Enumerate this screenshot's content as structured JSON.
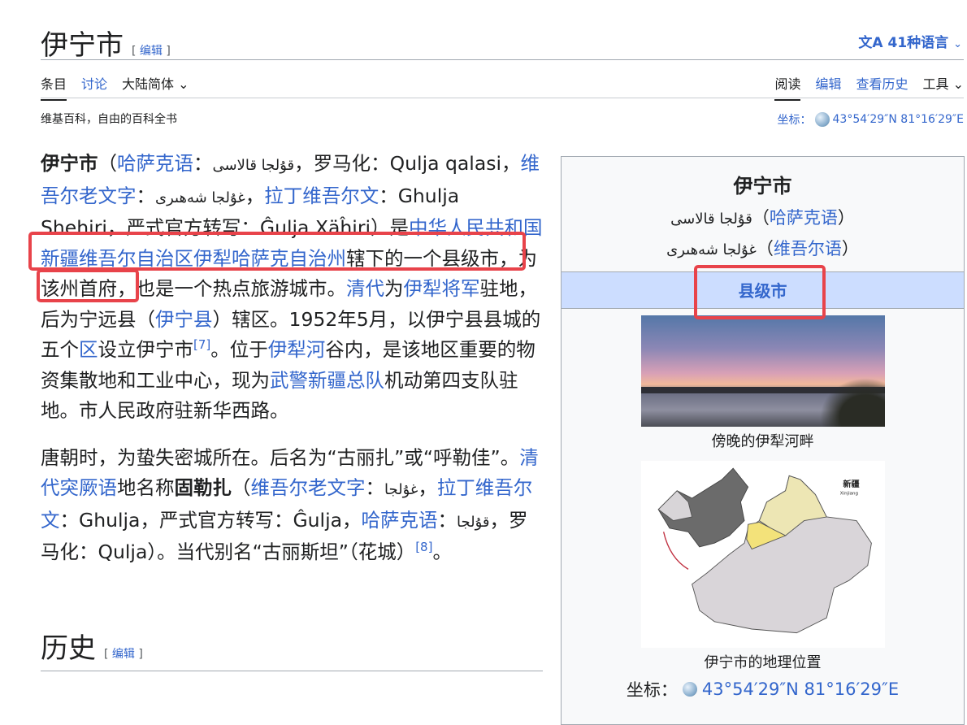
{
  "page": {
    "title": "伊宁市",
    "edit_label": "编辑",
    "languages": "41种语言",
    "tabs_left": [
      "条目",
      "讨论",
      "大陆简体"
    ],
    "tabs_right": [
      "阅读",
      "编辑",
      "查看历史",
      "工具"
    ],
    "tagline": "维基百科，自由的百科全书",
    "coord_label": "坐标：",
    "coord_value": "43°54′29″N 81°16′29″E"
  },
  "paragraphs": [
    [
      {
        "t": "伊宁市",
        "b": true
      },
      {
        "t": "（"
      },
      {
        "t": "哈萨克语",
        "l": true
      },
      {
        "t": "："
      },
      {
        "t": "قۇلجا قالاسى",
        "r": true
      },
      {
        "t": "，罗马化：Qulja qalasi，"
      },
      {
        "t": "维吾尔老文字",
        "l": true
      },
      {
        "t": "："
      },
      {
        "t": "غۇلجا شەھىرى",
        "r": true
      },
      {
        "t": "，"
      },
      {
        "t": "拉丁维吾尔文",
        "l": true
      },
      {
        "t": "：Ghulja Shehiri，严式官方转写：Ĝulja Xäĥiri）是"
      },
      {
        "t": "中华人民共和国新疆维吾尔自治区伊犁哈萨克自治州",
        "l": true
      },
      {
        "t": "辖下的一个县级市，为该州首府，也是一个热点旅游城市。"
      },
      {
        "t": "清代",
        "l": true
      },
      {
        "t": "为"
      },
      {
        "t": "伊犁将军",
        "l": true
      },
      {
        "t": "驻地，后为宁远县（"
      },
      {
        "t": "伊宁县",
        "l": true
      },
      {
        "t": "）辖区。1952年5月，以伊宁县县城的五个"
      },
      {
        "t": "区",
        "l": true
      },
      {
        "t": "设立伊宁市"
      },
      {
        "t": "[7]",
        "s": true
      },
      {
        "t": "。位于"
      },
      {
        "t": "伊犁河",
        "l": true
      },
      {
        "t": "谷内，是该地区重要的物资集散地和工业中心，现为"
      },
      {
        "t": "武警新疆总队",
        "l": true
      },
      {
        "t": "机动第四支队驻地。市人民政府驻新华西路。"
      }
    ],
    [
      {
        "t": "唐朝时，为蛰失密城所在。后名为“古丽扎”或“呼勒佳”。"
      },
      {
        "t": "清代突厥语",
        "l": true
      },
      {
        "t": "地名称"
      },
      {
        "t": "固勒扎",
        "b": true
      },
      {
        "t": "（"
      },
      {
        "t": "维吾尔老文字",
        "l": true
      },
      {
        "t": "："
      },
      {
        "t": "غۇلجا",
        "r": true
      },
      {
        "t": "，"
      },
      {
        "t": "拉丁维吾尔文",
        "l": true
      },
      {
        "t": "：Ghulja，严式官方转写：Ĝulja，"
      },
      {
        "t": "哈萨克语",
        "l": true
      },
      {
        "t": "："
      },
      {
        "t": "قۇلجا",
        "r": true
      },
      {
        "t": "，罗马化：Qulja）。当代别名“古丽斯坦”（花城）"
      },
      {
        "t": "[8]",
        "s": true
      },
      {
        "t": "。"
      }
    ]
  ],
  "section": {
    "title": "历史",
    "edit_label": "编辑"
  },
  "infobox": {
    "title": "伊宁市",
    "kazakh_name": "قۇلجا قالاسى",
    "kazakh_label": "哈萨克语",
    "uyghur_name": "غۇلجا شەھىرى",
    "uyghur_label": "维吾尔语",
    "type": "县级市",
    "photo_caption": "傍晚的伊犁河畔",
    "map_label_cn": "新疆",
    "map_label_en": "Xinjiang",
    "map_caption": "伊宁市的地理位置",
    "coord_label": "坐标：",
    "coord_value": "43°54′29″N 81°16′29″E"
  },
  "colors": {
    "link": "#3366cc",
    "highlight": "#e8434a",
    "infobox_header": "#ccddff"
  }
}
